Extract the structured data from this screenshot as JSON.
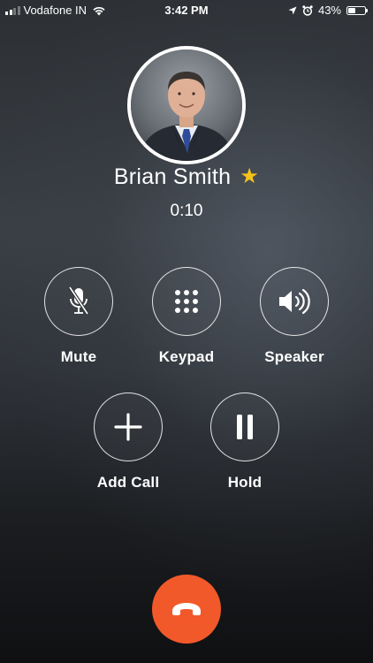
{
  "status_bar": {
    "carrier": "Vodafone IN",
    "time": "3:42 PM",
    "battery_percent": "43%",
    "battery_level": 0.43,
    "signal_bars": 2,
    "icons": [
      "signal-icon",
      "wifi-icon",
      "location-arrow-icon",
      "alarm-icon",
      "battery-icon"
    ]
  },
  "call": {
    "contact_name": "Brian Smith",
    "favorite_icon": "★",
    "duration": "0:10"
  },
  "controls": {
    "mute_label": "Mute",
    "keypad_label": "Keypad",
    "speaker_label": "Speaker",
    "add_call_label": "Add Call",
    "hold_label": "Hold"
  },
  "colors": {
    "end_call": "#f2592a",
    "favorite_star": "#f6c21a"
  }
}
